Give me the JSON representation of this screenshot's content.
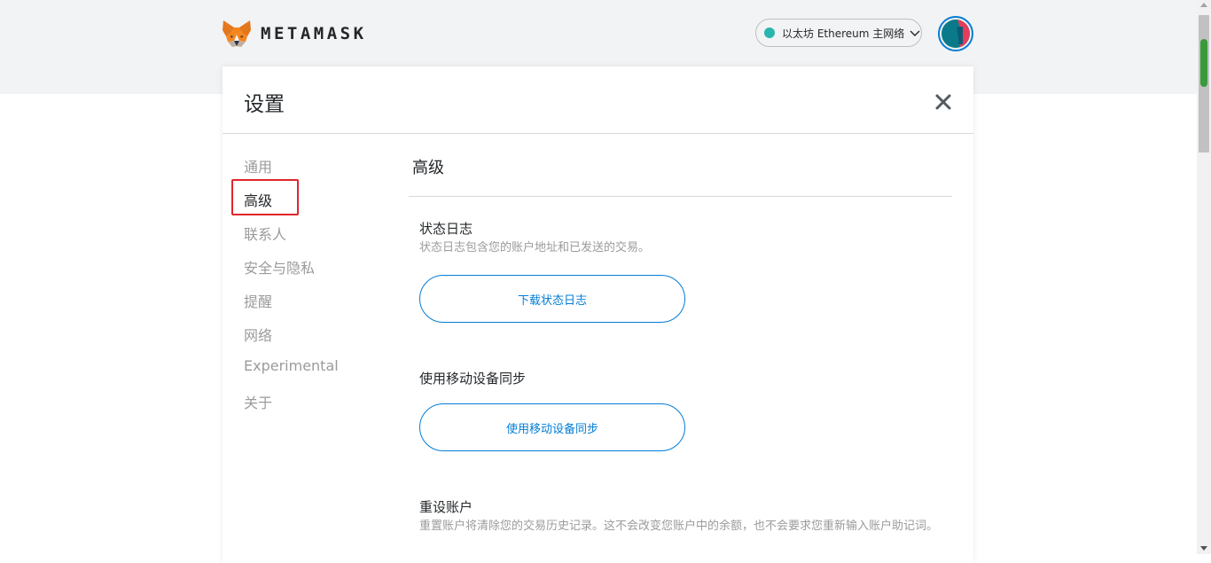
{
  "app": {
    "brand": "METAMASK",
    "colors": {
      "accent": "#037dd6",
      "network_dot": "#29b6af",
      "highlight": "#e0262b"
    }
  },
  "network": {
    "label": "以太坊 Ethereum 主网络",
    "icon": "chevron-down-icon"
  },
  "account": {
    "icon": "account-avatar"
  },
  "settings": {
    "title": "设置",
    "close_icon": "close-icon",
    "tabs": [
      {
        "label": "通用",
        "active": false
      },
      {
        "label": "高级",
        "active": true
      },
      {
        "label": "联系人",
        "active": false
      },
      {
        "label": "安全与隐私",
        "active": false
      },
      {
        "label": "提醒",
        "active": false
      },
      {
        "label": "网络",
        "active": false
      },
      {
        "label": "Experimental",
        "active": false
      },
      {
        "label": "关于",
        "active": false
      }
    ]
  },
  "advanced": {
    "title": "高级",
    "state_logs": {
      "title": "状态日志",
      "description": "状态日志包含您的账户地址和已发送的交易。",
      "button": "下载状态日志"
    },
    "sync": {
      "title": "使用移动设备同步",
      "button": "使用移动设备同步"
    },
    "reset": {
      "title": "重设账户",
      "description": "重置账户将清除您的交易历史记录。这不会改变您账户中的余额，也不会要求您重新输入账户助记词。"
    }
  }
}
